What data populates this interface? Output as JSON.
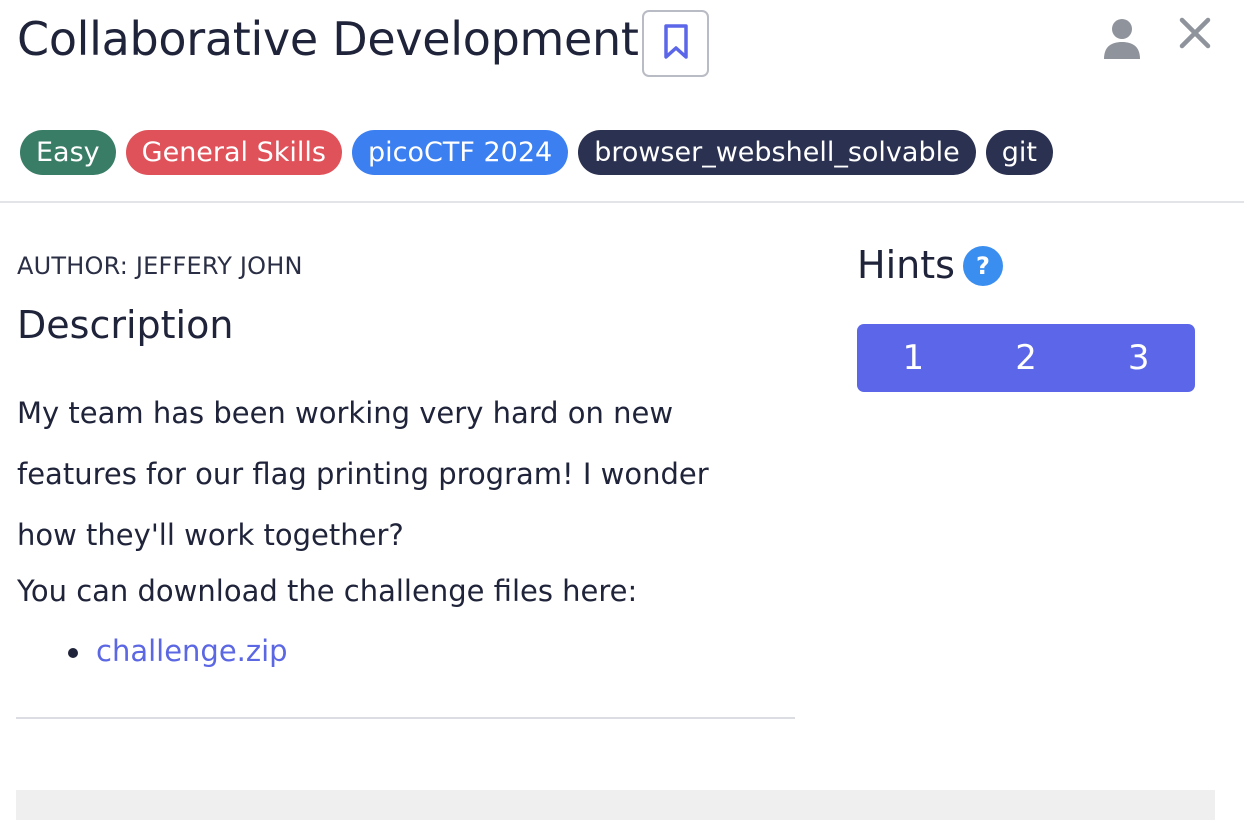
{
  "header": {
    "title": "Collaborative Development",
    "bookmark_icon": "bookmark-icon",
    "user_icon": "user-icon",
    "close_icon": "close-icon"
  },
  "tags": [
    {
      "label": "Easy",
      "color": "#3a7d66"
    },
    {
      "label": "General Skills",
      "color": "#e0525a"
    },
    {
      "label": "picoCTF 2024",
      "color": "#3b7ff0"
    },
    {
      "label": "browser_webshell_solvable",
      "color": "#2b3150"
    },
    {
      "label": "git",
      "color": "#2b3150"
    }
  ],
  "challenge": {
    "author": "AUTHOR: JEFFERY JOHN",
    "description_heading": "Description",
    "description": "My team has been working very hard on new features for our flag printing program! I wonder how they'll work together?",
    "download_text": "You can download the challenge files here:",
    "files": [
      "challenge.zip"
    ]
  },
  "hints": {
    "heading": "Hints",
    "help_icon": "question-icon",
    "help_symbol": "?",
    "buttons": [
      "1",
      "2",
      "3"
    ]
  },
  "colors": {
    "accent": "#5b67e8",
    "link": "#5b67e3",
    "help_badge": "#3a8ef0"
  }
}
